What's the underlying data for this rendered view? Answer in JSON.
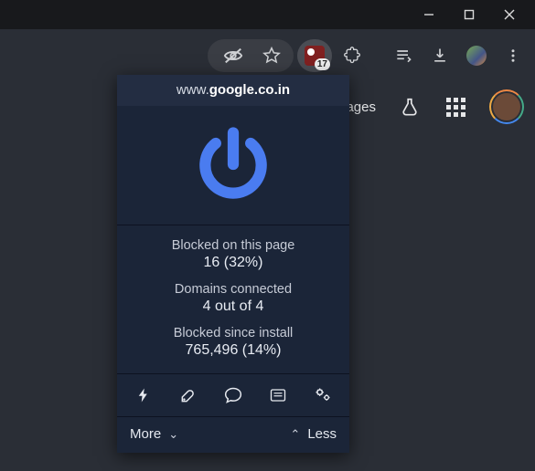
{
  "titlebar": {
    "min": "min",
    "max": "max",
    "close": "close"
  },
  "toolbar": {
    "ext_badge": "17",
    "icons": {
      "incognito": "incognito",
      "star": "star",
      "puzzle": "extensions",
      "playlist": "reading-list",
      "download": "downloads",
      "menu": "menu"
    }
  },
  "secbar": {
    "text": "mages",
    "labs": "labs",
    "apps": "apps"
  },
  "popup": {
    "domain_prefix": "www.",
    "domain_bold": "google.co.in",
    "stats": {
      "page_label": "Blocked on this page",
      "page_value": "16 (32%)",
      "domains_label": "Domains connected",
      "domains_value": "4 out of 4",
      "install_label": "Blocked since install",
      "install_value": "765,496 (14%)"
    },
    "tools": {
      "zap": "zap",
      "picker": "picker",
      "chat": "logger",
      "list": "dashboard",
      "gear": "settings"
    },
    "more": "More",
    "less": "Less"
  }
}
